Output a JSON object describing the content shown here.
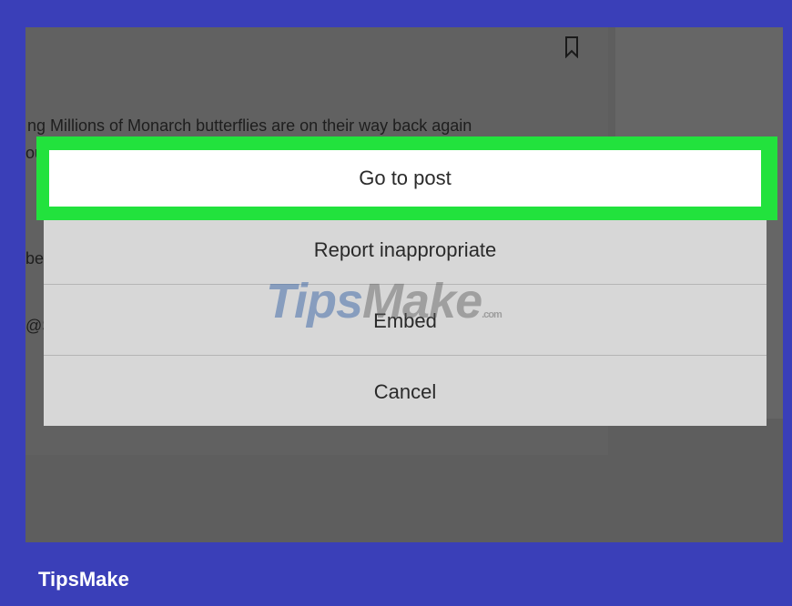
{
  "post": {
    "caption": "ng Millions of Monarch butterflies are on their way back again",
    "fragments": [
      "ou",
      "be",
      "@S"
    ]
  },
  "menu": {
    "items": [
      "Go to post",
      "Report inappropriate",
      "Embed",
      "Cancel"
    ]
  },
  "watermark": {
    "brand_start": "Tips",
    "brand_end": "Make",
    "suffix": ".com"
  },
  "footer": {
    "brand": "TipsMake"
  },
  "colors": {
    "frame": "#3a3fb8",
    "highlight": "#22e23d",
    "overlay": "#5e5e5e",
    "menu": "#d7d7d7"
  },
  "icons": {
    "bookmark": "bookmark-icon"
  }
}
